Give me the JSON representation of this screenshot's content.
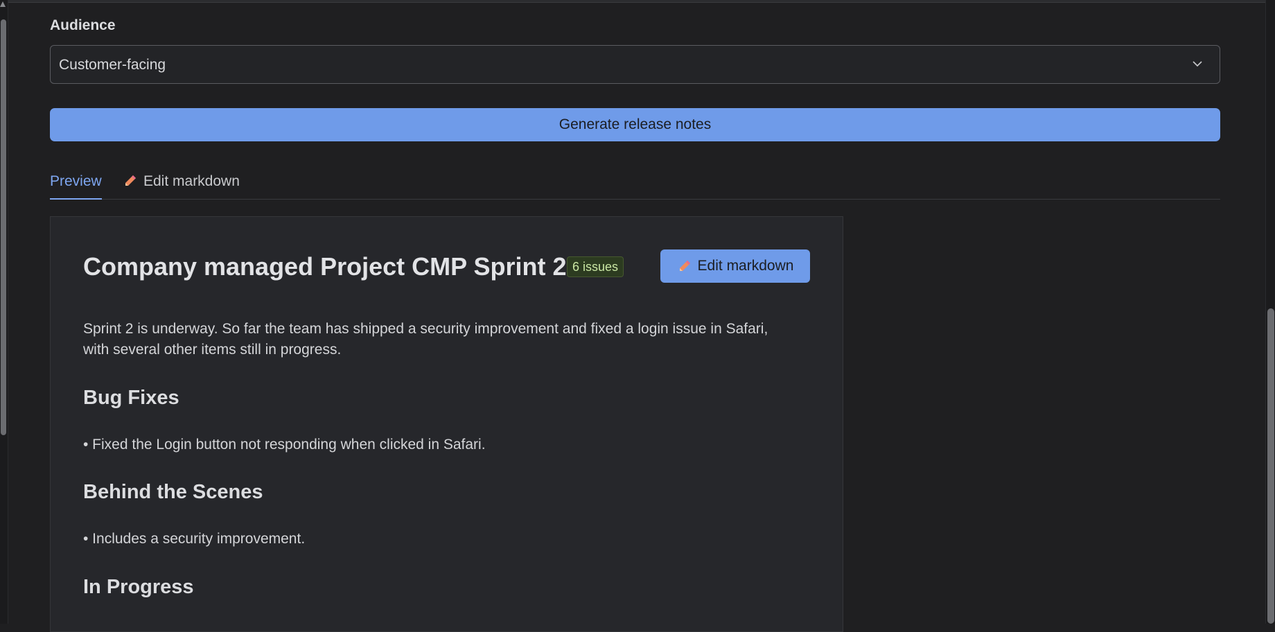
{
  "audience": {
    "label": "Audience",
    "selected": "Customer-facing"
  },
  "generate_button": "Generate release notes",
  "tabs": {
    "preview": "Preview",
    "edit": "Edit markdown"
  },
  "preview": {
    "title": "Company managed Project CMP Sprint 2",
    "badge": "6 issues",
    "edit_button": "Edit markdown",
    "summary": "Sprint 2 is underway. So far the team has shipped a security improvement and fixed a login issue in Safari, with several other items still in progress.",
    "sections": [
      {
        "heading": "Bug Fixes",
        "items": [
          "• Fixed the Login button not responding when clicked in Safari."
        ]
      },
      {
        "heading": "Behind the Scenes",
        "items": [
          "• Includes a security improvement."
        ]
      },
      {
        "heading": "In Progress",
        "items": []
      }
    ]
  },
  "icons": {
    "select_chevron": "chevron-down-icon",
    "tab_edit": "pencil-icon",
    "edit_button": "pencil-icon"
  },
  "colors": {
    "accent": "#6f9be9",
    "active_tab": "#7ea6f0",
    "badge_bg": "#2c3b20",
    "badge_text": "#c9e6a3"
  }
}
